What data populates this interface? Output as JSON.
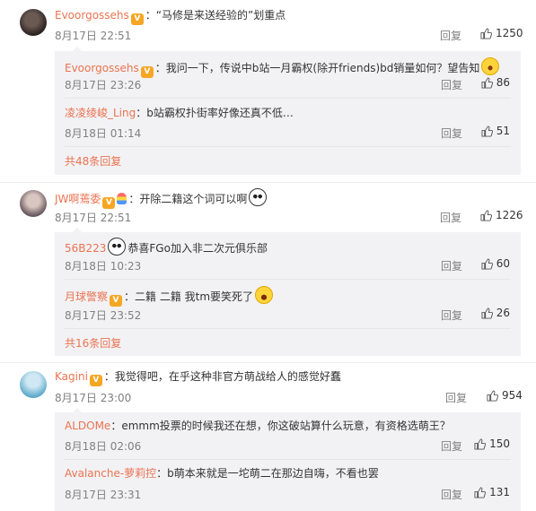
{
  "threads": [
    {
      "user": "Evoorgossehs",
      "text": "：“马修是来送经验的”划重点",
      "date": "8月17日 22:51",
      "reply_label": "回复",
      "likes": "1250",
      "sub": [
        {
          "user": "Evoorgossehs",
          "text": "：我问一下，传说中b站一月霸权(除开friends)bd销量如何？望告知",
          "date": "8月17日 23:26",
          "reply_label": "回复",
          "likes": "86"
        },
        {
          "user": "凌凌绫峻_Ling",
          "text": "：b站霸权扑街率好像还真不低…",
          "date": "8月18日 01:14",
          "reply_label": "回复",
          "likes": "51"
        }
      ],
      "more": "共48条回复"
    },
    {
      "user": "JW啊蔫委",
      "text": "：开除二籍这个词可以啊",
      "date": "8月17日 22:51",
      "reply_label": "回复",
      "likes": "1226",
      "sub": [
        {
          "user": "56B223",
          "text": "恭喜FGo加入非二次元俱乐部",
          "date": "8月18日 10:23",
          "reply_label": "回复",
          "likes": "60"
        },
        {
          "user": "月球警察",
          "text": "：二籍 二籍 我tm要笑死了",
          "date": "8月17日 23:52",
          "reply_label": "回复",
          "likes": "26"
        }
      ],
      "more": "共16条回复"
    },
    {
      "user": "Kagini",
      "text": "：我觉得吧，在乎这种非官方萌战给人的感觉好蠢",
      "date": "8月17日 23:00",
      "reply_label": "回复",
      "likes": "954",
      "sub": [
        {
          "user": "ALDOMe",
          "text": "：emmm投票的时候我还在想，你这破站算什么玩意，有资格选萌王？",
          "date": "8月18日 02:06",
          "reply_label": "回复",
          "likes": "150"
        },
        {
          "user": "Avalanche-萝莉控",
          "text": "：b萌本来就是一坨萌二在那边自嗨，不看也罢",
          "date": "8月17日 23:31",
          "reply_label": "回复",
          "likes": "131"
        }
      ]
    }
  ],
  "colors": {
    "username": "#eb7350",
    "meta": "#808080",
    "reply_bg": "#f2f2f5"
  },
  "icons": {
    "vip": "vip-crown-icon",
    "like": "thumb-up-icon"
  }
}
